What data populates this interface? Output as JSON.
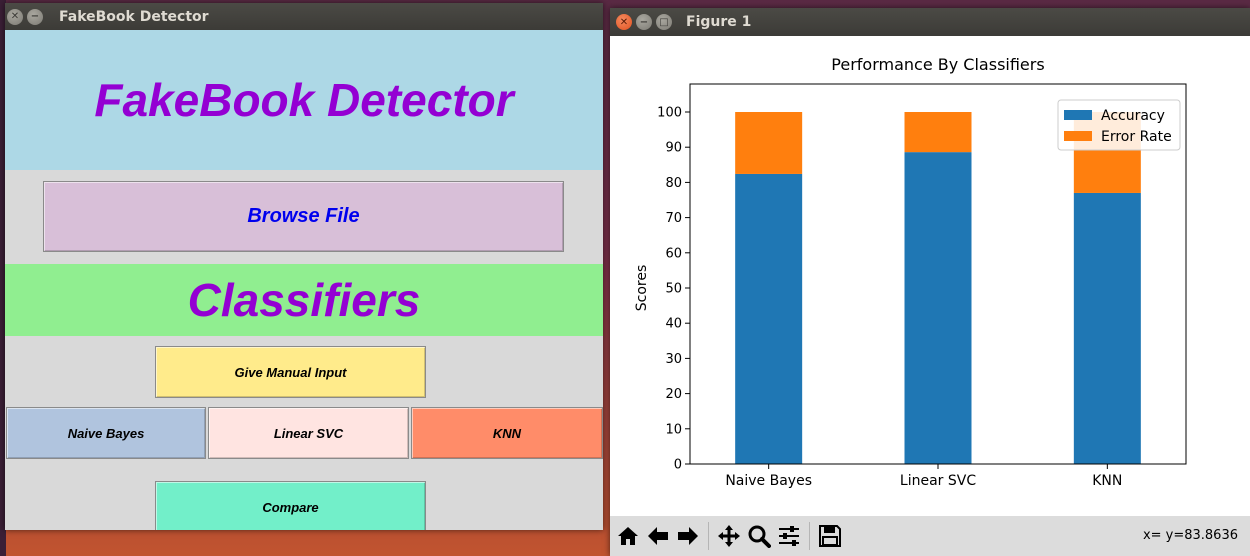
{
  "tk_window": {
    "title": "FakeBook Detector",
    "header_text": "FakeBook Detector",
    "browse_label": "Browse File",
    "classifiers_heading": "Classifiers",
    "manual_input_label": "Give Manual Input",
    "naive_bayes_label": "Naive Bayes",
    "linear_svc_label": "Linear SVC",
    "knn_label": "KNN",
    "compare_label": "Compare"
  },
  "figure_window": {
    "title": "Figure 1",
    "coordinate_readout": "x= y=83.8636",
    "toolbar": [
      "home-icon",
      "back-arrow-icon",
      "forward-arrow-icon",
      "pan-icon",
      "zoom-icon",
      "configure-subplots-icon",
      "save-icon"
    ]
  },
  "chart_data": {
    "type": "bar",
    "stacked": true,
    "title": "Performance By Classifiers",
    "xlabel": "",
    "ylabel": "Scores",
    "categories": [
      "Naive Bayes",
      "Linear SVC",
      "KNN"
    ],
    "series": [
      {
        "name": "Accuracy",
        "color": "#1f77b4",
        "values": [
          82.4,
          88.6,
          77.0
        ]
      },
      {
        "name": "Error Rate",
        "color": "#ff7f0e",
        "values": [
          17.6,
          11.4,
          23.0
        ]
      }
    ],
    "ylim": [
      0,
      100
    ],
    "yticks": [
      "0",
      "10",
      "20",
      "30",
      "40",
      "50",
      "60",
      "70",
      "80",
      "90",
      "100"
    ],
    "grid": false,
    "legend_position": "top-right"
  }
}
